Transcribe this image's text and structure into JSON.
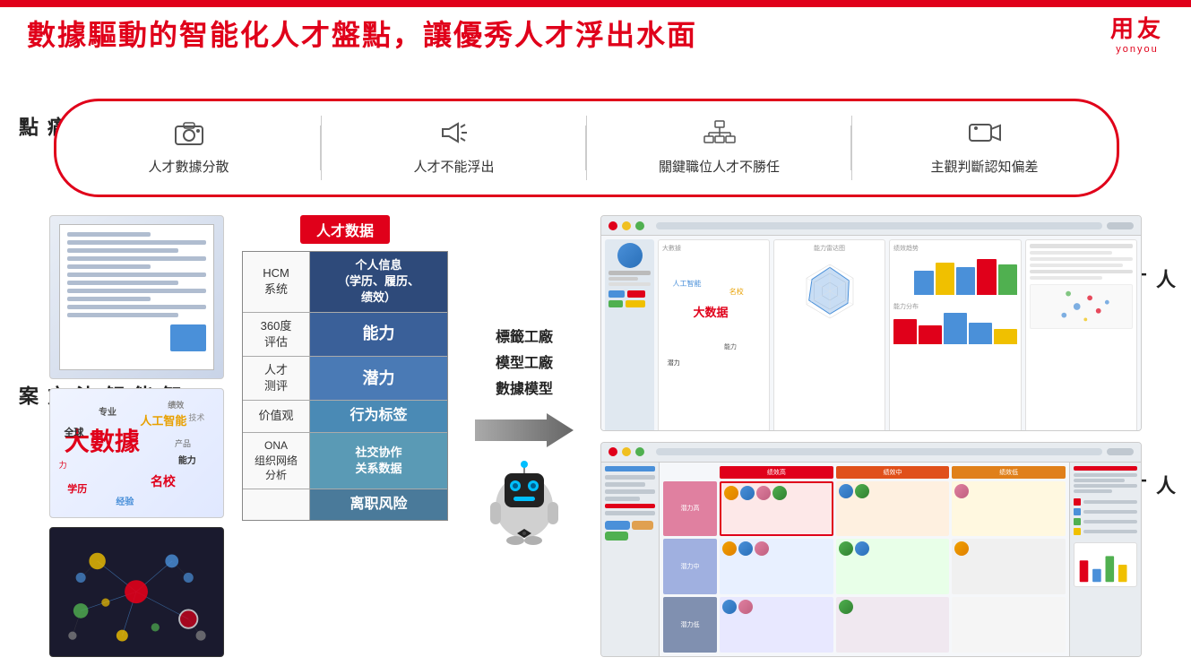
{
  "topbar": {},
  "header": {
    "title": "數據驅動的智能化人才盤點，讓優秀人才浮出水面",
    "logo_main": "用友",
    "logo_sub": "yonyou"
  },
  "left_labels": {
    "yewu": "業務痛點",
    "zhineng": "智能解決方案"
  },
  "right_labels": {
    "quanjing": "人才全景畫像",
    "jiugong": "人才九宮格"
  },
  "pain_points": [
    {
      "icon": "📷",
      "text": "人才數據分散"
    },
    {
      "icon": "📢",
      "text": "人才不能浮出"
    },
    {
      "icon": "🔀",
      "text": "關鍵職位人才不勝任"
    },
    {
      "icon": "🎬",
      "text": "主觀判斷認知偏差"
    }
  ],
  "data_section": {
    "header": "人才数据",
    "rows": [
      {
        "left": "HCM\n系统",
        "right": "个人信息\n（学历、履历、\n绩效）",
        "bg_class": "bg-dark-blue"
      },
      {
        "left": "360度\n评估",
        "right": "能力",
        "bg_class": "bg-medium-blue"
      },
      {
        "left": "人才\n测评",
        "right": "潜力",
        "bg_class": "bg-steel"
      },
      {
        "left": "价值观",
        "right": "行为标签",
        "bg_class": "bg-mid"
      },
      {
        "left": "ONA\n组织网络\n分析",
        "right": "社交协作\n关系数据",
        "bg_class": "bg-light-blue"
      },
      {
        "left": "",
        "right": "离职风险",
        "bg_class": "bg-slate"
      }
    ]
  },
  "factory_labels": {
    "line1": "標籤工廠",
    "line2": "模型工廠",
    "line3": "數據模型"
  },
  "wordcloud_words": [
    {
      "text": "大數據",
      "class": "wc-big"
    },
    {
      "text": "人工智能",
      "class": "wc-med1"
    },
    {
      "text": "名校",
      "class": "wc-med2"
    },
    {
      "text": "全球",
      "class": "wc-med3"
    },
    {
      "text": "学历",
      "class": "wc-med4"
    },
    {
      "text": "专业",
      "class": "wc-med5"
    },
    {
      "text": "经验",
      "class": "wc-med6"
    },
    {
      "text": "能力",
      "class": "wc-med7"
    },
    {
      "text": "绩效",
      "class": "wc-med8"
    }
  ],
  "jiugong_cards": [
    {
      "header": "绩效高/潜力高",
      "color": "#e08080",
      "avatars": [
        "orange",
        "blue",
        "pink"
      ]
    },
    {
      "header": "绩效中/潜力高",
      "color": "#e0a080",
      "avatars": [
        "blue",
        "green"
      ]
    },
    {
      "header": "绩效低/潜力高",
      "color": "#e0c080",
      "avatars": [
        "pink"
      ]
    },
    {
      "header": "绩效高/潜力中",
      "color": "#a0c080",
      "avatars": [
        "orange",
        "blue"
      ]
    },
    {
      "header": "绩效中/潜力中",
      "color": "#80b080",
      "avatars": [
        "green",
        "pink",
        "blue"
      ]
    },
    {
      "header": "绩效低/潜力中",
      "color": "#80a0c0",
      "avatars": [
        "orange"
      ]
    },
    {
      "header": "绩效高/潜力低",
      "color": "#8080c0",
      "avatars": [
        "blue",
        "pink"
      ]
    },
    {
      "header": "绩效中/潜力低",
      "color": "#a080b0",
      "avatars": [
        "green"
      ]
    },
    {
      "header": "绩效低/潜力低",
      "color": "#c080a0",
      "avatars": []
    }
  ]
}
